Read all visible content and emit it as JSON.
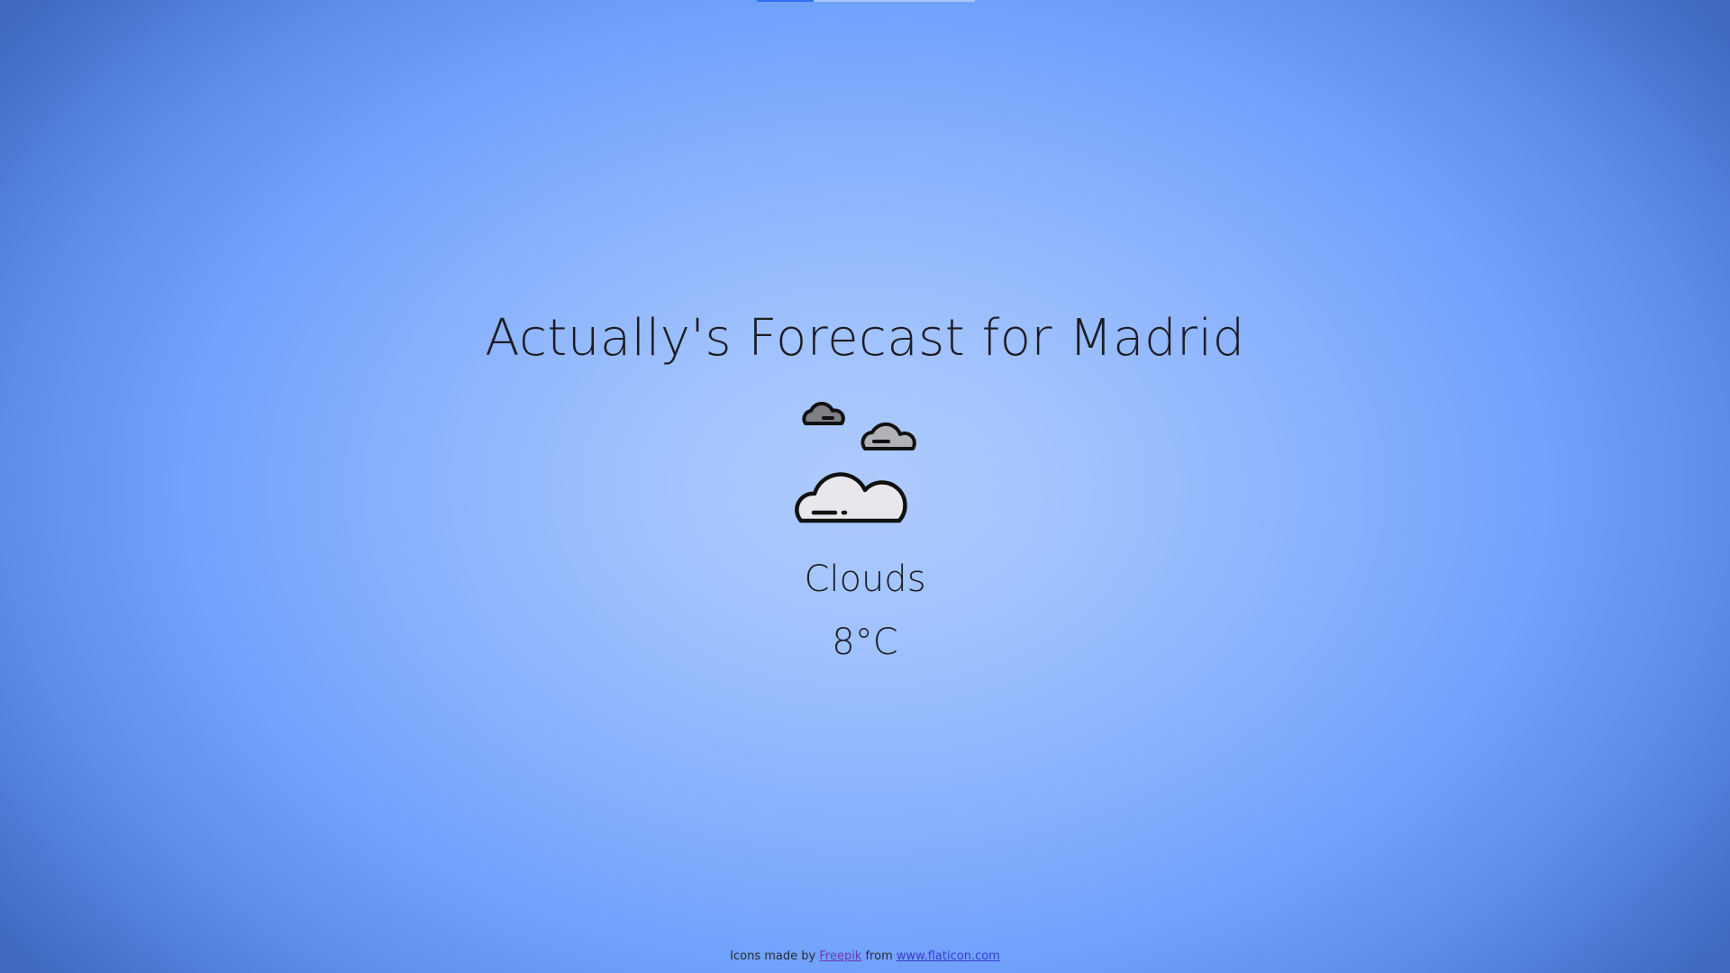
{
  "header": {
    "title": "Actually's Forecast for Madrid"
  },
  "loader": {
    "progress": 0.26,
    "color": "#2f6ff0"
  },
  "weather": {
    "icon": "clouds-icon",
    "condition": "Clouds",
    "temperature": "8°C"
  },
  "footer": {
    "prefix": "Icons made by",
    "author_link": "Freepik",
    "middle": "from",
    "site_link": "www.flaticon.com"
  }
}
